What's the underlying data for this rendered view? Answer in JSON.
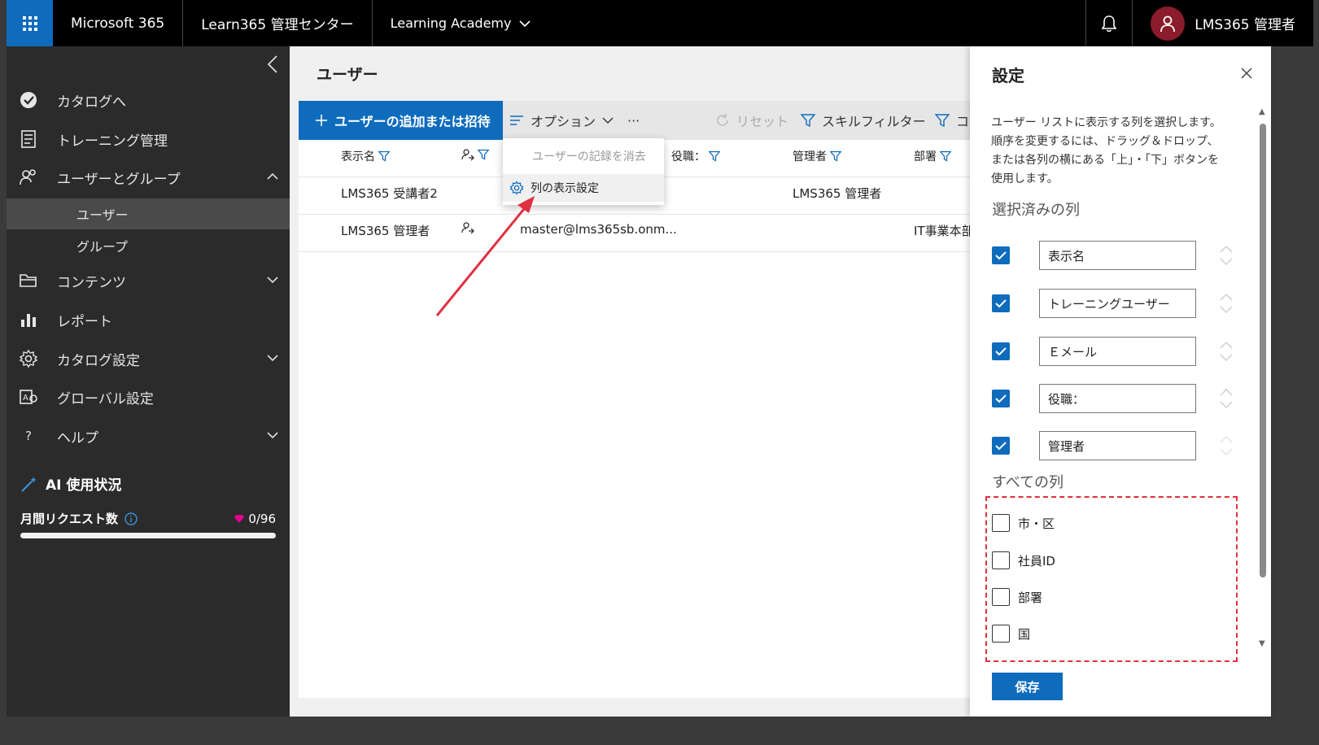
{
  "topbar": {
    "app_name": "Microsoft 365",
    "admin_center": "Learn365 管理センター",
    "tenant": "Learning Academy",
    "user_name": "LMS365 管理者"
  },
  "nav": {
    "items": [
      {
        "label": "カタログへ",
        "icon": "catalog-icon"
      },
      {
        "label": "トレーニング管理",
        "icon": "training-icon"
      },
      {
        "label": "ユーザーとグループ",
        "icon": "users-icon",
        "expanded": true
      },
      {
        "label": "コンテンツ",
        "icon": "folder-icon"
      },
      {
        "label": "レポート",
        "icon": "chart-icon"
      },
      {
        "label": "カタログ設定",
        "icon": "gear-icon"
      },
      {
        "label": "グローバル設定",
        "icon": "global-settings-icon"
      },
      {
        "label": "ヘルプ",
        "icon": "help-icon"
      }
    ],
    "sub_items": [
      {
        "label": "ユーザー",
        "active": true
      },
      {
        "label": "グループ",
        "active": false
      }
    ],
    "ai_title": "AI 使用状況",
    "monthly_requests_label": "月間リクエスト数",
    "monthly_requests_value": "0/96",
    "monthly_requests_fraction": 0
  },
  "main": {
    "page_title": "ユーザー",
    "toolbar": {
      "add_label": "ユーザーの追加または招待",
      "options_label": "オプション",
      "more_label": "···",
      "reset_label": "リセット",
      "skill_filter_label": "スキルフィルター",
      "extra_label": "コ"
    },
    "columns": [
      "表示名",
      "役職：",
      "管理者",
      "部署"
    ],
    "rows": [
      {
        "name": "LMS365 受講者2",
        "email": "",
        "manager": "LMS365 管理者",
        "dept": ""
      },
      {
        "name": "LMS365 管理者",
        "email": "master@lms365sb.onm...",
        "manager": "",
        "dept": "IT事業本部"
      }
    ],
    "dropdown": {
      "clear_label": "ユーザーの記録を消去",
      "colset_label": "列の表示設定"
    }
  },
  "panel": {
    "title": "設定",
    "description": "ユーザー リストに表示する列を選択します。順序を変更するには、ドラッグ＆ドロップ、または各列の横にある「上」・「下」ボタンを使用します。",
    "selected_heading": "選択済みの列",
    "selected": [
      "表示名",
      "トレーニングユーザー",
      "Ｅメール",
      "役職：",
      "管理者"
    ],
    "all_heading": "すべての列",
    "all": [
      "市・区",
      "社員ID",
      "部署",
      "国"
    ],
    "save_label": "保存"
  },
  "colors": {
    "accent": "#0f6cbd",
    "annotation": "#e03040",
    "avatar": "#8a1c2b"
  }
}
